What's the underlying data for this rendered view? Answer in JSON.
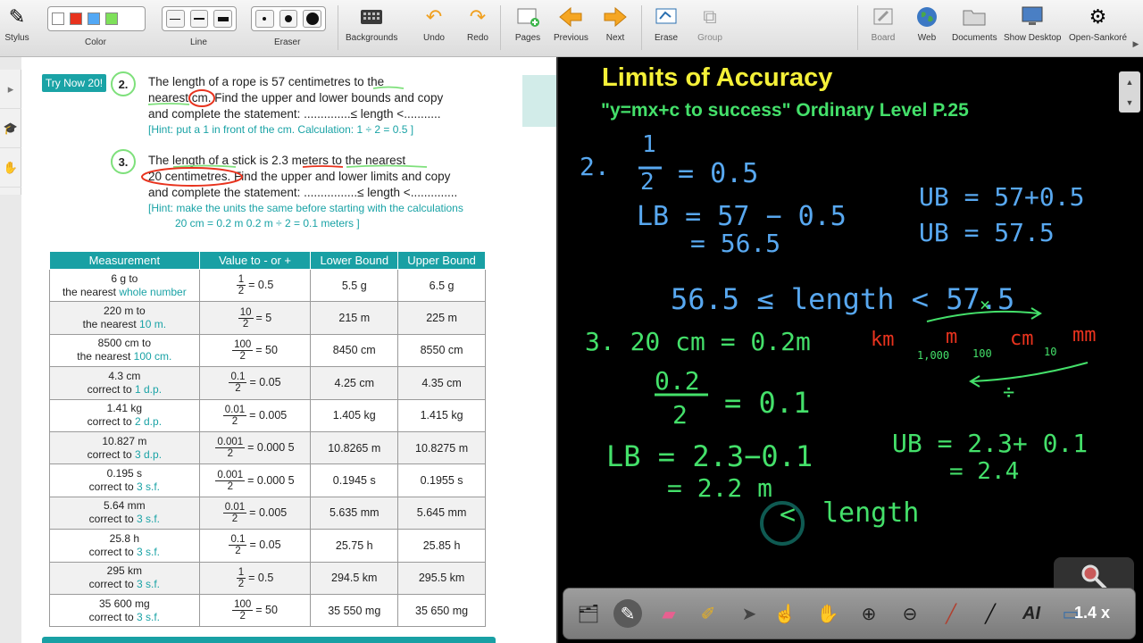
{
  "toolbar": {
    "stylus": "Stylus",
    "color": "Color",
    "line": "Line",
    "eraser": "Eraser",
    "backgrounds": "Backgrounds",
    "undo": "Undo",
    "redo": "Redo",
    "pages": "Pages",
    "previous": "Previous",
    "next": "Next",
    "erase": "Erase",
    "group": "Group",
    "board": "Board",
    "web": "Web",
    "documents": "Documents",
    "show_desktop": "Show Desktop",
    "open_sankore": "Open-Sankoré",
    "swatch_colors": [
      "#ffffff",
      "#e8331e",
      "#52a8f5",
      "#7ee05a"
    ]
  },
  "doc": {
    "try_now": "Try Now 20!",
    "q2": {
      "num": "2.",
      "line1": "The length of a rope is 57 centimetres to the",
      "line2": "nearest cm. Find the upper and  lower bounds and copy",
      "line3": "and complete the statement:  ..............≤ length <...........",
      "hint": "[Hint: put a 1 in front of the cm. Calculation: 1 ÷ 2 =  0.5 ]"
    },
    "q3": {
      "num": "3.",
      "line1": "The length of a stick is 2.3 meters to the nearest",
      "line2": "20 centimetres. Find the upper and lower limits and copy",
      "line3": "and complete the statement: ................≤ length <..............",
      "hint1": "[Hint: make the units the same before starting with the calculations",
      "hint2": "20 cm = 0.2 m    0.2 m ÷ 2 =  0.1 meters ]"
    },
    "table": {
      "headers": [
        "Measurement",
        "Value to - or +",
        "Lower Bound",
        "Upper Bound"
      ],
      "rows": [
        {
          "m1": "6 g to",
          "m2": "the nearest ",
          "m2b": "whole number",
          "fn": "1",
          "fd": "2",
          "val": "= 0.5",
          "lb": "5.5 g",
          "ub": "6.5 g"
        },
        {
          "m1": "220 m to",
          "m2": "the nearest ",
          "m2b": "10 m.",
          "fn": "10",
          "fd": "2",
          "val": "= 5",
          "lb": "215 m",
          "ub": "225 m"
        },
        {
          "m1": "8500 cm to",
          "m2": "the nearest ",
          "m2b": "100 cm.",
          "fn": "100",
          "fd": "2",
          "val": "= 50",
          "lb": "8450 cm",
          "ub": "8550 cm"
        },
        {
          "m1": "4.3 cm",
          "m2": "correct to ",
          "m2b": "1 d.p.",
          "fn": "0.1",
          "fd": "2",
          "val": "= 0.05",
          "lb": "4.25 cm",
          "ub": "4.35 cm"
        },
        {
          "m1": "1.41 kg",
          "m2": "correct to ",
          "m2b": "2 d.p.",
          "fn": "0.01",
          "fd": "2",
          "val": "= 0.005",
          "lb": "1.405 kg",
          "ub": "1.415 kg"
        },
        {
          "m1": "10.827 m",
          "m2": "correct to ",
          "m2b": "3 d.p.",
          "fn": "0.001",
          "fd": "2",
          "val": "= 0.000 5",
          "lb": "10.8265 m",
          "ub": "10.8275 m"
        },
        {
          "m1": "0.195 s",
          "m2": "correct to ",
          "m2b": "3 s.f.",
          "fn": "0.001",
          "fd": "2",
          "val": "= 0.000 5",
          "lb": "0.1945 s",
          "ub": "0.1955 s"
        },
        {
          "m1": "5.64 mm",
          "m2": "correct to ",
          "m2b": "3 s.f.",
          "fn": "0.01",
          "fd": "2",
          "val": "= 0.005",
          "lb": "5.635 mm",
          "ub": "5.645 mm"
        },
        {
          "m1": "25.8 h",
          "m2": "correct to ",
          "m2b": "3 s.f.",
          "fn": "0.1",
          "fd": "2",
          "val": "= 0.05",
          "lb": "25.75 h",
          "ub": "25.85 h"
        },
        {
          "m1": "295 km",
          "m2": "correct to ",
          "m2b": "3 s.f.",
          "fn": "1",
          "fd": "2",
          "val": "= 0.5",
          "lb": "294.5 km",
          "ub": "295.5 km"
        },
        {
          "m1": "35 600 mg",
          "m2": "correct to ",
          "m2b": "3 s.f.",
          "fn": "100",
          "fd": "2",
          "val": "= 50",
          "lb": "35 550 mg",
          "ub": "35 650 mg"
        }
      ]
    }
  },
  "board": {
    "title": "Limits of Accuracy",
    "subtitle": "\"y=mx+c to success\"  Ordinary Level P.25",
    "ink": {
      "l1": "2.",
      "half_n": "1",
      "half_d": "2",
      "eq05": "= 0.5",
      "lb1": "LB = 57 − 0.5",
      "lb1b": "= 56.5",
      "ub1": "UB = 57+0.5",
      "ub1b": "UB = 57.5",
      "stmt": "56.5 ≤ length < 57.5",
      "x_mark": "×",
      "q3": "3.  20 cm = 0.2m",
      "units": [
        "km",
        "m",
        "cm",
        "mm"
      ],
      "factors": [
        "1,000",
        "100",
        "10"
      ],
      "div_sign": "÷",
      "frac_n": "0.2",
      "frac_d": "2",
      "eq01": "= 0.1",
      "lb2": "LB = 2.3−0.1",
      "lb2b": "= 2.2 m",
      "ub2": "UB = 2.3+ 0.1",
      "ub2b": "= 2.4",
      "lt": "<",
      "length": "length"
    }
  },
  "zoom": "1.4 x"
}
